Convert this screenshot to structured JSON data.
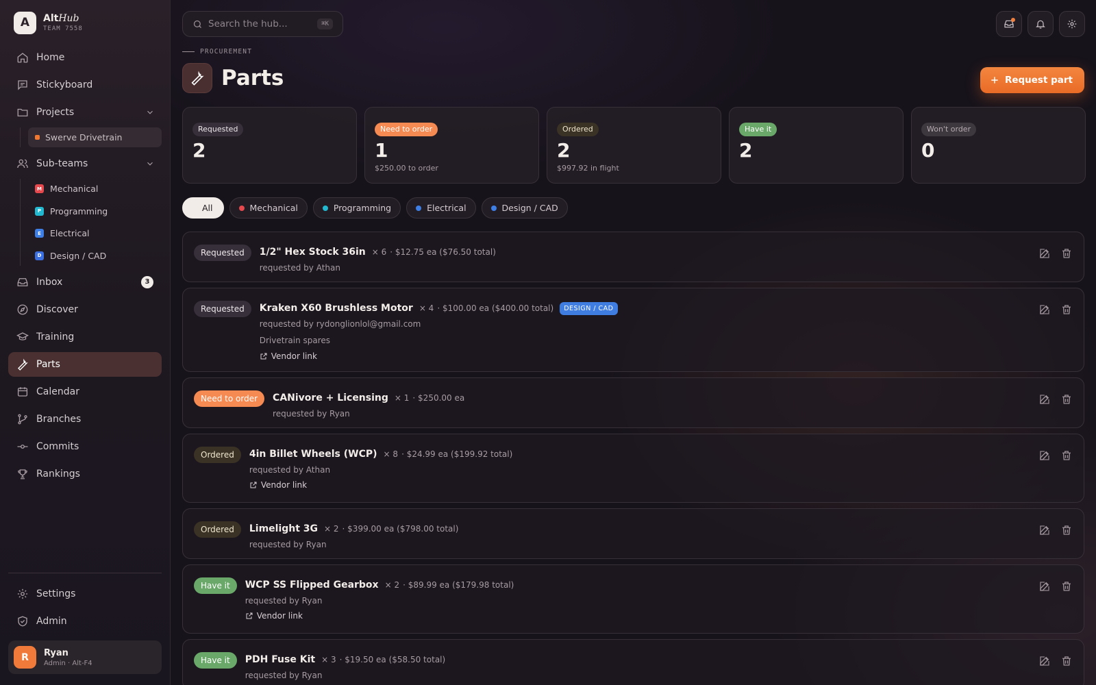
{
  "brand": {
    "logo_letter": "A",
    "name_a": "Alt",
    "name_b": "Hub",
    "team": "TEAM 7558"
  },
  "nav": {
    "home": "Home",
    "stickyboard": "Stickyboard",
    "projects": "Projects",
    "projects_items": [
      "Swerve Drivetrain"
    ],
    "subteams": "Sub-teams",
    "subteam_items": [
      {
        "letter": "M",
        "label": "Mechanical",
        "color": "#e5484d"
      },
      {
        "letter": "P",
        "label": "Programming",
        "color": "#22b8cf"
      },
      {
        "letter": "E",
        "label": "Electrical",
        "color": "#3e7fe6"
      },
      {
        "letter": "D",
        "label": "Design / CAD",
        "color": "#3b6fe0"
      }
    ],
    "inbox": "Inbox",
    "inbox_count": "3",
    "discover": "Discover",
    "training": "Training",
    "parts": "Parts",
    "calendar": "Calendar",
    "branches": "Branches",
    "commits": "Commits",
    "rankings": "Rankings",
    "settings": "Settings",
    "admin": "Admin"
  },
  "user": {
    "initial": "R",
    "name": "Ryan",
    "role": "Admin · Alt-F4"
  },
  "search": {
    "placeholder": "Search the hub...",
    "shortcut": "⌘K"
  },
  "header": {
    "crumb": "PROCUREMENT",
    "title": "Parts",
    "request_button": "Request part"
  },
  "stats": [
    {
      "label": "Requested",
      "value": "2",
      "sub": ""
    },
    {
      "label": "Need to order",
      "value": "1",
      "sub": "$250.00 to order"
    },
    {
      "label": "Ordered",
      "value": "2",
      "sub": "$997.92 in flight"
    },
    {
      "label": "Have it",
      "value": "2",
      "sub": ""
    },
    {
      "label": "Won't order",
      "value": "0",
      "sub": ""
    }
  ],
  "filters": {
    "all": "All",
    "items": [
      {
        "label": "Mechanical",
        "color": "#e5484d"
      },
      {
        "label": "Programming",
        "color": "#22b8cf"
      },
      {
        "label": "Electrical",
        "color": "#3e7fe6"
      },
      {
        "label": "Design / CAD",
        "color": "#3e7fe6"
      }
    ]
  },
  "parts": [
    {
      "status": "Requested",
      "name": "1/2\" Hex Stock 36in",
      "qty": "× 6",
      "price": "· $12.75 ea ($76.50 total)",
      "requested_by": "requested by Athan"
    },
    {
      "status": "Requested",
      "name": "Kraken X60 Brushless Motor",
      "qty": "× 4",
      "price": "· $100.00 ea ($400.00 total)",
      "tag": "DESIGN / CAD",
      "requested_by": "requested by rydonglionlol@gmail.com",
      "notes": "Drivetrain spares",
      "vendor": "Vendor link"
    },
    {
      "status": "Need to order",
      "name": "CANivore + Licensing",
      "qty": "× 1",
      "price": "· $250.00 ea",
      "requested_by": "requested by Ryan"
    },
    {
      "status": "Ordered",
      "name": "4in Billet Wheels (WCP)",
      "qty": "× 8",
      "price": "· $24.99 ea ($199.92 total)",
      "requested_by": "requested by Athan",
      "vendor": "Vendor link"
    },
    {
      "status": "Ordered",
      "name": "Limelight 3G",
      "qty": "× 2",
      "price": "· $399.00 ea ($798.00 total)",
      "requested_by": "requested by Ryan"
    },
    {
      "status": "Have it",
      "name": "WCP SS Flipped Gearbox",
      "qty": "× 2",
      "price": "· $89.99 ea ($179.98 total)",
      "requested_by": "requested by Ryan",
      "vendor": "Vendor link"
    },
    {
      "status": "Have it",
      "name": "PDH Fuse Kit",
      "qty": "× 3",
      "price": "· $19.50 ea ($58.50 total)",
      "requested_by": "requested by Ryan"
    }
  ]
}
